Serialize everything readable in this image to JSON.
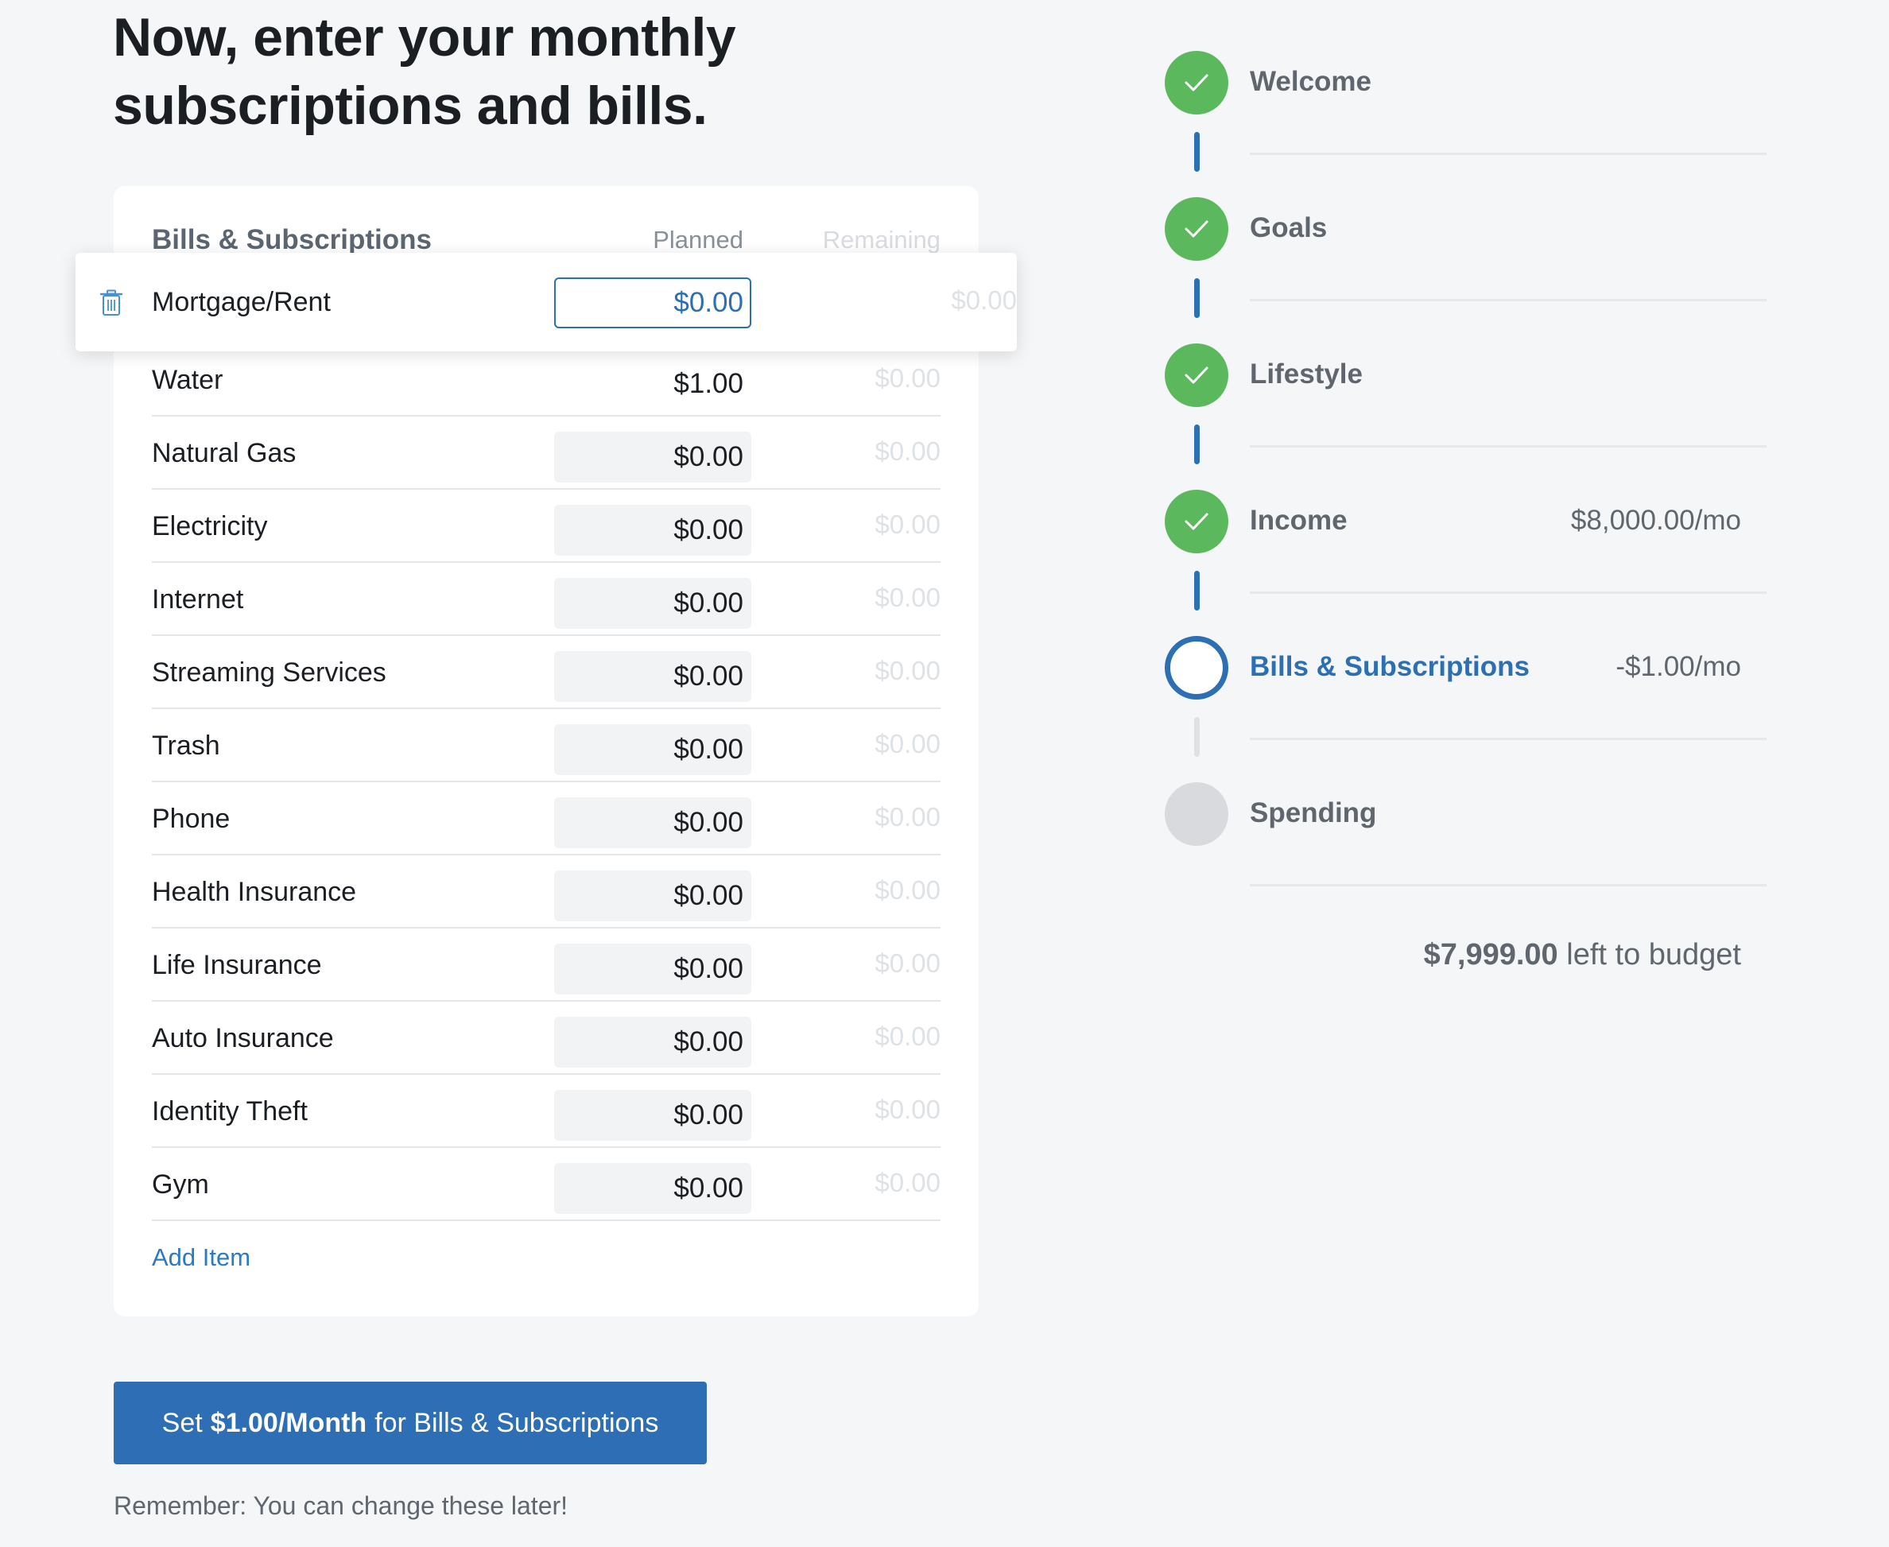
{
  "page": {
    "title": "Now, enter your monthly subscriptions and bills."
  },
  "table": {
    "header_name": "Bills & Subscriptions",
    "header_planned": "Planned",
    "header_remaining": "Remaining",
    "active_row": {
      "name": "Mortgage/Rent",
      "planned": "$0.00",
      "remaining": "$0.00"
    },
    "rows": [
      {
        "name": "Water",
        "planned": "$1.00",
        "remaining": "$0.00"
      },
      {
        "name": "Natural Gas",
        "planned": "$0.00",
        "remaining": "$0.00"
      },
      {
        "name": "Electricity",
        "planned": "$0.00",
        "remaining": "$0.00"
      },
      {
        "name": "Internet",
        "planned": "$0.00",
        "remaining": "$0.00"
      },
      {
        "name": "Streaming Services",
        "planned": "$0.00",
        "remaining": "$0.00"
      },
      {
        "name": "Trash",
        "planned": "$0.00",
        "remaining": "$0.00"
      },
      {
        "name": "Phone",
        "planned": "$0.00",
        "remaining": "$0.00"
      },
      {
        "name": "Health Insurance",
        "planned": "$0.00",
        "remaining": "$0.00"
      },
      {
        "name": "Life Insurance",
        "planned": "$0.00",
        "remaining": "$0.00"
      },
      {
        "name": "Auto Insurance",
        "planned": "$0.00",
        "remaining": "$0.00"
      },
      {
        "name": "Identity Theft",
        "planned": "$0.00",
        "remaining": "$0.00"
      },
      {
        "name": "Gym",
        "planned": "$0.00",
        "remaining": "$0.00"
      }
    ],
    "add_item_label": "Add Item"
  },
  "cta": {
    "prefix": "Set",
    "amount": "$1.00/Month",
    "suffix": "for Bills & Subscriptions"
  },
  "reminder": "Remember: You can change these later!",
  "steps": [
    {
      "label": "Welcome",
      "status": "done",
      "value": "",
      "unit": "",
      "icon": "check-icon"
    },
    {
      "label": "Goals",
      "status": "done",
      "value": "",
      "unit": "",
      "icon": "check-icon"
    },
    {
      "label": "Lifestyle",
      "status": "done",
      "value": "",
      "unit": "",
      "icon": "check-icon"
    },
    {
      "label": "Income",
      "status": "done",
      "value": "$8,000.00",
      "unit": "/mo",
      "icon": "check-icon"
    },
    {
      "label": "Bills & Subscriptions",
      "status": "current",
      "value": "-$1.00",
      "unit": "/mo",
      "icon": ""
    },
    {
      "label": "Spending",
      "status": "todo",
      "value": "",
      "unit": "",
      "icon": ""
    }
  ],
  "summary": {
    "amount": "$7,999.00",
    "text": "left to budget"
  },
  "colors": {
    "accent": "#2c6fb3",
    "done": "#5cb85c",
    "todo": "#d8dadd",
    "background": "#f5f6f8"
  }
}
